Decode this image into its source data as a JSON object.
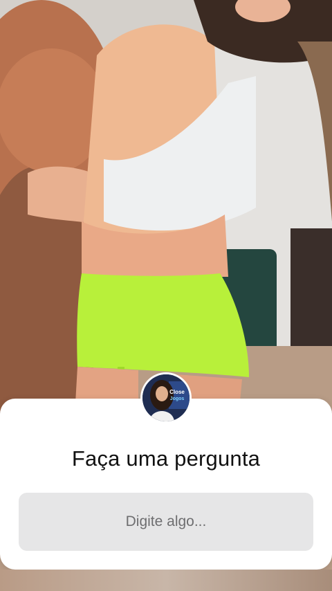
{
  "question_sticker": {
    "title": "Faça uma pergunta",
    "input_placeholder": "Digite algo..."
  },
  "avatar": {
    "badge_text": "Close Jogos"
  },
  "colors": {
    "card_background": "#ffffff",
    "input_background": "#e6e6e7",
    "shorts_accent": "#b8f03a",
    "teddy_bear": "#b8714e"
  }
}
